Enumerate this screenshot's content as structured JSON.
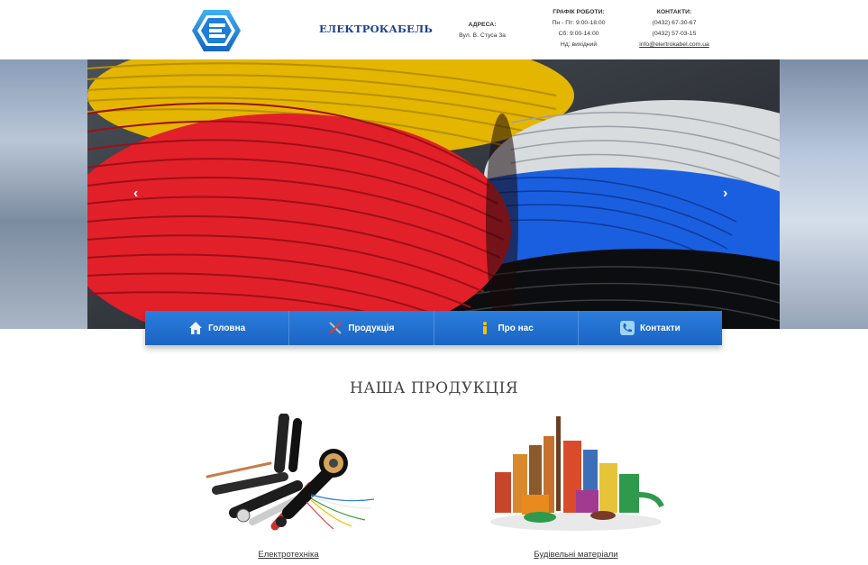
{
  "header": {
    "brand": "ЕЛЕКТРОКАБЕЛЬ",
    "address": {
      "title": "АДРЕСА:",
      "line1": "Вул. В. Стуса 3а"
    },
    "hours": {
      "title": "ГРАФІК РОБОТИ:",
      "line1": "Пн - Пт: 9:00-18:00",
      "line2": "Сб: 9:00-14:00",
      "line3": "Нд: вихідний"
    },
    "contacts": {
      "title": "КОНТАКТИ:",
      "phone1": "(0432) 67-30-67",
      "phone2": "(0432) 57-03-15",
      "email": "info@elertrokabel.com.ua"
    }
  },
  "slider": {
    "prev_icon": "chevron-left-icon",
    "next_icon": "chevron-right-icon"
  },
  "nav": {
    "items": [
      {
        "label": "Головна",
        "icon": "home-icon"
      },
      {
        "label": "Продукція",
        "icon": "tools-icon"
      },
      {
        "label": "Про нас",
        "icon": "info-icon"
      },
      {
        "label": "Контакти",
        "icon": "phone-icon"
      }
    ]
  },
  "products": {
    "title": "НАША ПРОДУКЦІЯ",
    "items": [
      {
        "label": "Електротехніка"
      },
      {
        "label": "Будівельні матеріали"
      }
    ]
  },
  "colors": {
    "brand": "#1d3f8f",
    "nav": "#1f6fd1",
    "logo": "#1e88e5"
  }
}
